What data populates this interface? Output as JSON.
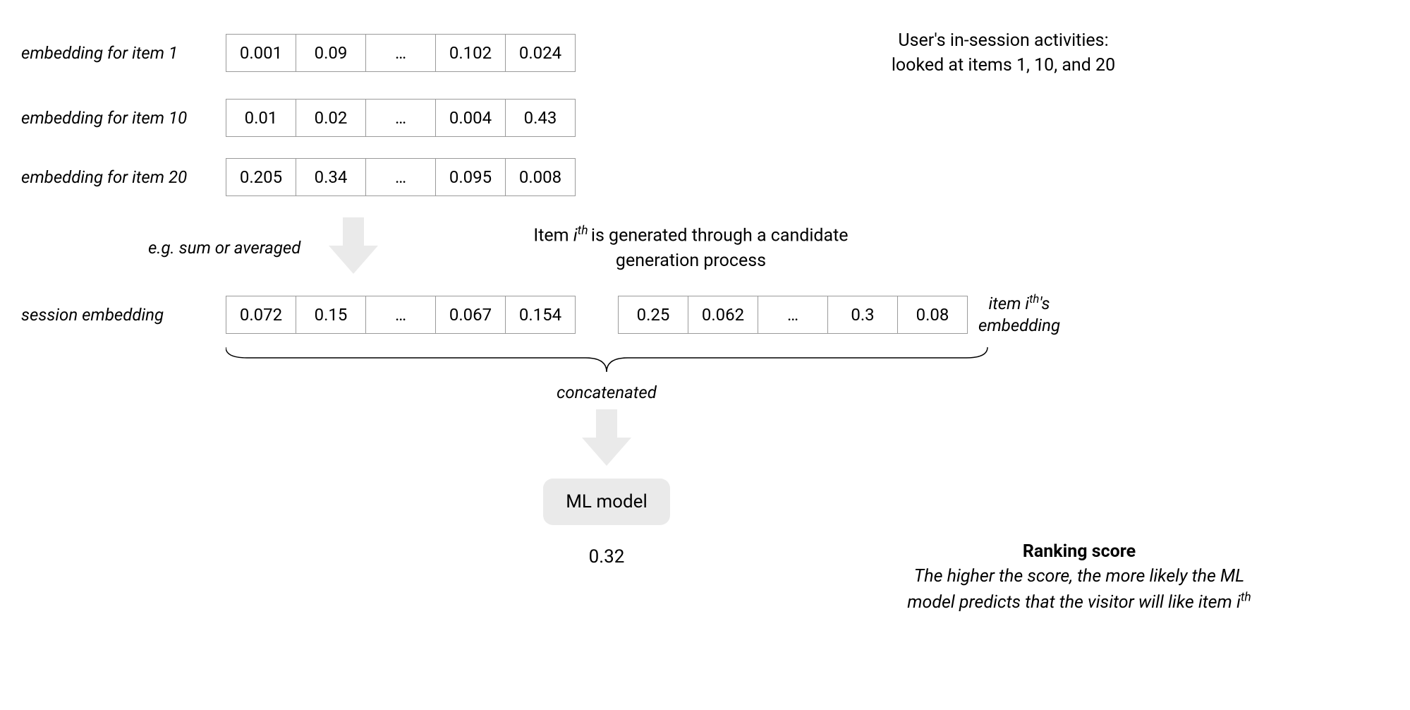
{
  "embeddings": {
    "item1": {
      "label": "embedding for item 1",
      "cells": [
        "0.001",
        "0.09",
        "…",
        "0.102",
        "0.024"
      ]
    },
    "item10": {
      "label": "embedding for item 10",
      "cells": [
        "0.01",
        "0.02",
        "…",
        "0.004",
        "0.43"
      ]
    },
    "item20": {
      "label": "embedding for item 20",
      "cells": [
        "0.205",
        "0.34",
        "…",
        "0.095",
        "0.008"
      ]
    },
    "session": {
      "label": "session embedding",
      "cells": [
        "0.072",
        "0.15",
        "…",
        "0.067",
        "0.154"
      ]
    },
    "item_i": {
      "cells": [
        "0.25",
        "0.062",
        "…",
        "0.3",
        "0.08"
      ]
    }
  },
  "activities_line1": "User's in-session activities:",
  "activities_line2": "looked at items 1, 10, and 20",
  "agg_label": "e.g. sum or averaged",
  "candidate_prefix": "Item ",
  "candidate_i": "i",
  "candidate_th": "th ",
  "candidate_suffix": "is generated through a candidate",
  "candidate_line2": "generation process",
  "item_i_label_prefix": "item ",
  "item_i_label_suffix": "'s",
  "item_i_label_line2": "embedding",
  "concat_label": "concatenated",
  "ml_label": "ML model",
  "score_value": "0.32",
  "score_title": "Ranking score",
  "score_sub_prefix": "The higher the score, the more likely the ML",
  "score_sub_mid": "model predicts that the visitor will like item ",
  "i_char": "i",
  "th_char": "th"
}
